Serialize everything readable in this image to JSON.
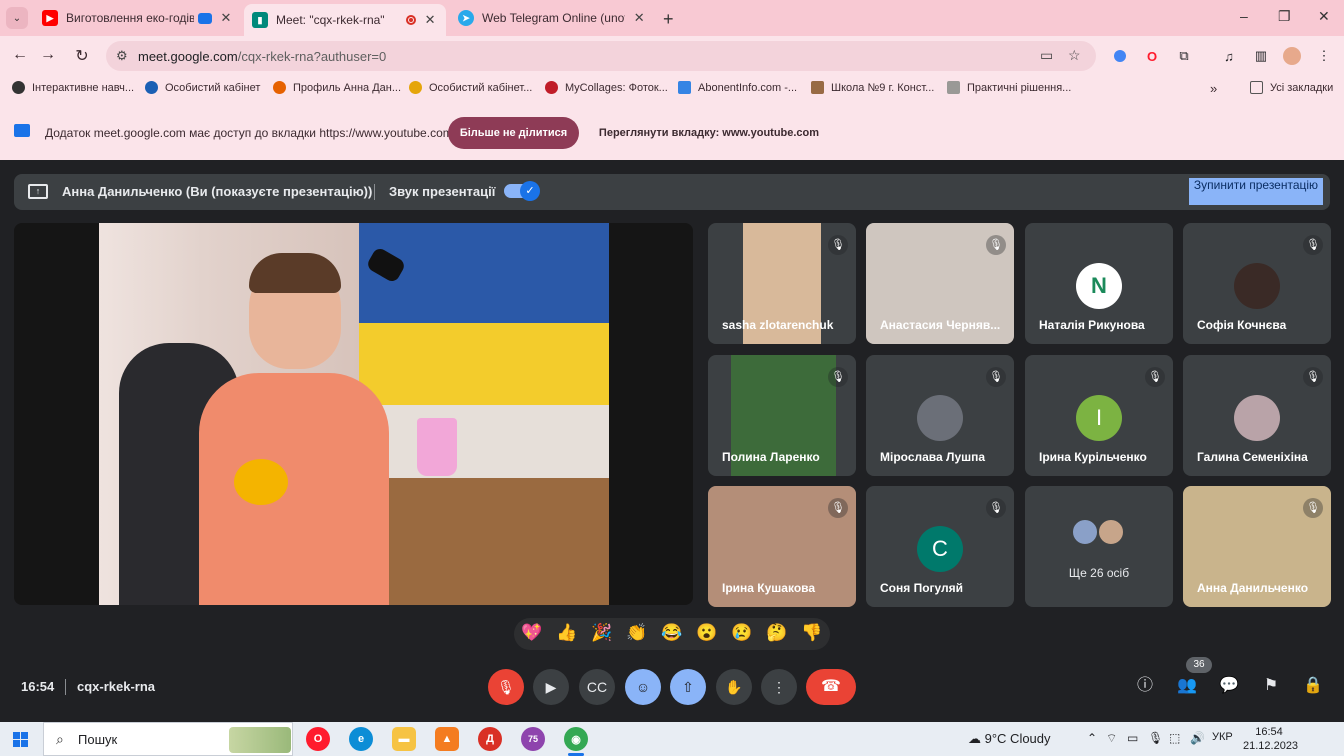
{
  "browser": {
    "tabs": [
      {
        "title": "Виготовлення еко-годівни",
        "favicon": "youtube-icon",
        "color": "#ff0000"
      },
      {
        "title": "Meet: \"cqx-rkek-rna\"",
        "favicon": "meet-icon",
        "color": "#00897b",
        "active": true
      },
      {
        "title": "Web Telegram Online (unoffici",
        "favicon": "telegram-icon",
        "color": "#29a9eb"
      }
    ],
    "url_domain": "meet.google.com",
    "url_path": "/cqx-rkek-rna?authuser=0",
    "bookmarks": [
      {
        "label": "Інтерактивне навч...",
        "color": "#333333"
      },
      {
        "label": "Особистий кабінет",
        "color": "#1a5fb4"
      },
      {
        "label": "Профиль Анна Дан...",
        "color": "#e66100"
      },
      {
        "label": "Особистий кабінет...",
        "color": "#e5a50a"
      },
      {
        "label": "MyCollages: Фоток...",
        "color": "#c01c28"
      },
      {
        "label": "AbonentInfo.com -...",
        "color": "#3584e4"
      },
      {
        "label": "Школа №9 г. Конст...",
        "color": "#986a44"
      },
      {
        "label": "Практичні рішення...",
        "color": "#9a9996"
      }
    ],
    "all_bookmarks": "Усі закладки",
    "window_controls": [
      "–",
      "❐",
      "✕"
    ]
  },
  "infobar": {
    "message": "Додаток meet.google.com має доступ до вкладки https://www.youtube.com",
    "stop_sharing": "Більше не ділитися",
    "view_tab": "Переглянути вкладку: www.youtube.com"
  },
  "meet": {
    "presenting_text": "Анна Данильченко (Ви (показуєте презентацію))",
    "audio_label": "Звук презентації",
    "stop_presenting": "Зупинити презентацію",
    "participants": [
      {
        "name": "sasha zlotarenchuk",
        "type": "video",
        "color": "#d8b99a"
      },
      {
        "name": "Анастасия Черняв...",
        "type": "video",
        "color": "#cfc6bf"
      },
      {
        "name": "Наталія Рикунова",
        "type": "avatar",
        "initial": "N",
        "color": "#ffffff"
      },
      {
        "name": "Софія Кочнєва",
        "type": "avatar-photo",
        "color": "#3a2a26"
      },
      {
        "name": "Полина Ларенко",
        "type": "video",
        "color": "#3d6b3a"
      },
      {
        "name": "Мірослава Лушпа",
        "type": "avatar-photo",
        "color": "#6b6f78"
      },
      {
        "name": "Ірина Курільченко",
        "type": "avatar",
        "initial": "І",
        "color": "#7cb342"
      },
      {
        "name": "Галина Семеніхіна",
        "type": "avatar-photo",
        "color": "#b9a3a8"
      },
      {
        "name": "Ірина Кушакова",
        "type": "video",
        "color": "#b48e78"
      },
      {
        "name": "Соня Погуляй",
        "type": "avatar",
        "initial": "С",
        "color": "#00796b"
      },
      {
        "name": "Ще 26 осіб",
        "type": "more"
      },
      {
        "name": "Анна Данильченко",
        "type": "video",
        "color": "#c9b48c"
      }
    ],
    "reactions": [
      "💖",
      "👍",
      "🎉",
      "👏",
      "😂",
      "😮",
      "😢",
      "🤔",
      "👎"
    ],
    "time": "16:54",
    "meeting_code": "cqx-rkek-rna",
    "people_count": "36"
  },
  "taskbar": {
    "search_placeholder": "Пошук",
    "weather": "9°C  Cloudy",
    "language": "УКР",
    "clock_time": "16:54",
    "clock_date": "21.12.2023",
    "apps": [
      {
        "name": "opera-icon",
        "color": "#ff1b2d",
        "glyph": "O"
      },
      {
        "name": "edge-icon",
        "color": "#0c8dd6",
        "glyph": "e"
      },
      {
        "name": "file-explorer-icon",
        "color": "#f6c343",
        "glyph": "▬"
      },
      {
        "name": "app-orange-icon",
        "color": "#f47c20",
        "glyph": "▲"
      },
      {
        "name": "app-red-icon",
        "color": "#d93025",
        "glyph": "Д"
      },
      {
        "name": "app-purple-icon",
        "color": "#8e44ad",
        "glyph": "75"
      },
      {
        "name": "chrome-icon",
        "color": "#34a853",
        "glyph": "◉"
      }
    ]
  }
}
